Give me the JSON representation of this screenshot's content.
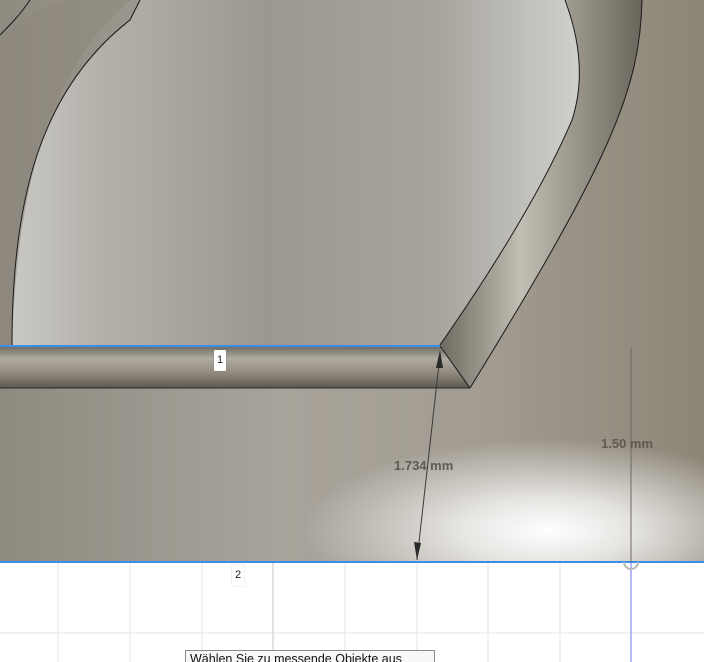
{
  "viewport": {
    "measurements": {
      "distance_label": "1.734 mm",
      "height_label": "1.50 mm"
    },
    "markers": {
      "first": "1",
      "second": "2"
    },
    "status_hint": "Wählen Sie zu messende Objekte aus"
  },
  "colors": {
    "selection_edge": "#3a8ee6",
    "model_surface": "#9a9487",
    "grid_line": "#e6e6ea"
  }
}
